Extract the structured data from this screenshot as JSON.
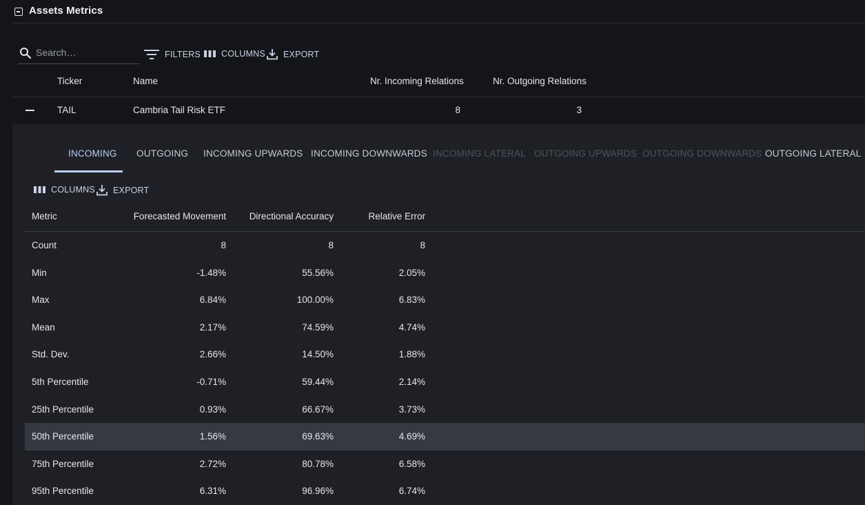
{
  "section": {
    "title": "Assets Metrics",
    "collapse_icon": "minus-square-icon"
  },
  "toolbar": {
    "search_placeholder": "Search…",
    "filters_label": "FILTERS",
    "columns_label": "COLUMNS",
    "export_label": "EXPORT"
  },
  "main_table": {
    "headers": [
      "Ticker",
      "Name",
      "Nr. Incoming Relations",
      "Nr. Outgoing Relations"
    ],
    "rows": [
      {
        "ticker": "TAIL",
        "name": "Cambria Tail Risk ETF",
        "incoming": "8",
        "outgoing": "3"
      }
    ]
  },
  "detail": {
    "tabs": [
      {
        "label": "INCOMING",
        "active": true,
        "disabled": false
      },
      {
        "label": "OUTGOING",
        "active": false,
        "disabled": false
      },
      {
        "label": "INCOMING UPWARDS",
        "active": false,
        "disabled": false
      },
      {
        "label": "INCOMING DOWNWARDS",
        "active": false,
        "disabled": false
      },
      {
        "label": "INCOMING LATERAL",
        "active": false,
        "disabled": true
      },
      {
        "label": "OUTGOING UPWARDS",
        "active": false,
        "disabled": true
      },
      {
        "label": "OUTGOING DOWNWARDS",
        "active": false,
        "disabled": true
      },
      {
        "label": "OUTGOING LATERAL",
        "active": false,
        "disabled": false
      }
    ],
    "toolbar": {
      "columns_label": "COLUMNS",
      "export_label": "EXPORT"
    },
    "headers": [
      "Metric",
      "Forecasted Movement",
      "Directional Accuracy",
      "Relative Error"
    ],
    "rows": [
      {
        "metric": "Count",
        "forecasted": "8",
        "accuracy": "8",
        "error": "8"
      },
      {
        "metric": "Min",
        "forecasted": "-1.48%",
        "accuracy": "55.56%",
        "error": "2.05%"
      },
      {
        "metric": "Max",
        "forecasted": "6.84%",
        "accuracy": "100.00%",
        "error": "6.83%"
      },
      {
        "metric": "Mean",
        "forecasted": "2.17%",
        "accuracy": "74.59%",
        "error": "4.74%"
      },
      {
        "metric": "Std. Dev.",
        "forecasted": "2.66%",
        "accuracy": "14.50%",
        "error": "1.88%"
      },
      {
        "metric": "5th Percentile",
        "forecasted": "-0.71%",
        "accuracy": "59.44%",
        "error": "2.14%"
      },
      {
        "metric": "25th Percentile",
        "forecasted": "0.93%",
        "accuracy": "66.67%",
        "error": "3.73%"
      },
      {
        "metric": "50th Percentile",
        "forecasted": "1.56%",
        "accuracy": "69.63%",
        "error": "4.69%"
      },
      {
        "metric": "75th Percentile",
        "forecasted": "2.72%",
        "accuracy": "80.78%",
        "error": "6.58%"
      },
      {
        "metric": "95th Percentile",
        "forecasted": "6.31%",
        "accuracy": "96.96%",
        "error": "6.74%"
      }
    ]
  },
  "colors": {
    "background": "#141519",
    "panel": "#1e2026",
    "row_highlight": "#363941",
    "accent": "#b9cdf0",
    "tool_text": "#c9d2e3"
  }
}
